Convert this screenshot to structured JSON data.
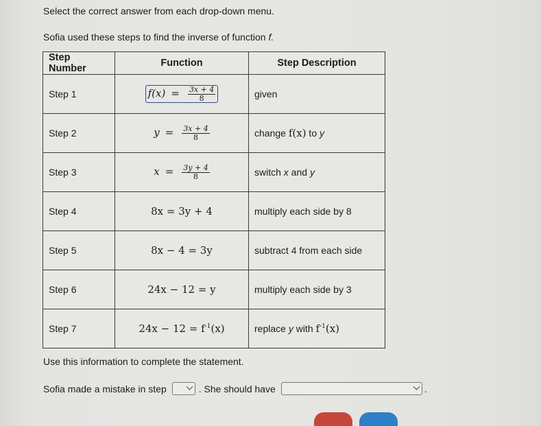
{
  "instruction": "Select the correct answer from each drop-down menu.",
  "intro": {
    "text": "Sofia used these steps to find the inverse of function",
    "function_name": "f."
  },
  "table": {
    "headers": [
      "Step Number",
      "Function",
      "Step Description"
    ],
    "rows": [
      {
        "step": "Step 1",
        "function": {
          "lhs": "f(x)",
          "num": "3x + 4",
          "den": "8"
        },
        "description": {
          "pre": "given",
          "var1": "",
          "mid": "",
          "var2": ""
        }
      },
      {
        "step": "Step 2",
        "function": {
          "lhs": "y",
          "num": "3x + 4",
          "den": "8"
        },
        "description": {
          "pre": "change ",
          "var1": "f(x)",
          "mid": " to ",
          "var2": "y"
        }
      },
      {
        "step": "Step 3",
        "function": {
          "lhs": "x",
          "num": "3y + 4",
          "den": "8"
        },
        "description": {
          "pre": "switch ",
          "var1": "x",
          "mid": " and ",
          "var2": "y"
        }
      },
      {
        "step": "Step 4",
        "function": {
          "text": "8x = 3y + 4"
        },
        "description": {
          "pre": "multiply each side by 8"
        }
      },
      {
        "step": "Step 5",
        "function": {
          "text": "8x − 4 = 3y"
        },
        "description": {
          "pre": "subtract 4 from each side"
        }
      },
      {
        "step": "Step 6",
        "function": {
          "text": "24x − 12 = y"
        },
        "description": {
          "pre": "multiply each side by 3"
        }
      },
      {
        "step": "Step 7",
        "function": {
          "text_pre": "24x − 12 = f",
          "sup": "-1",
          "text_post": "(x)"
        },
        "description": {
          "pre": "replace ",
          "var1": "y",
          "mid": " with ",
          "fn": "f",
          "sup": "-1",
          "post": "(x)"
        }
      }
    ]
  },
  "use_info": "Use this information to complete the statement.",
  "statement": {
    "part1": "Sofia made a mistake in step",
    "part2": ". She should have",
    "part3": ".",
    "step_dropdown_value": "",
    "fix_dropdown_value": ""
  },
  "buttons": {
    "reset_color": "#c6463a",
    "next_color": "#2f7fc8"
  }
}
